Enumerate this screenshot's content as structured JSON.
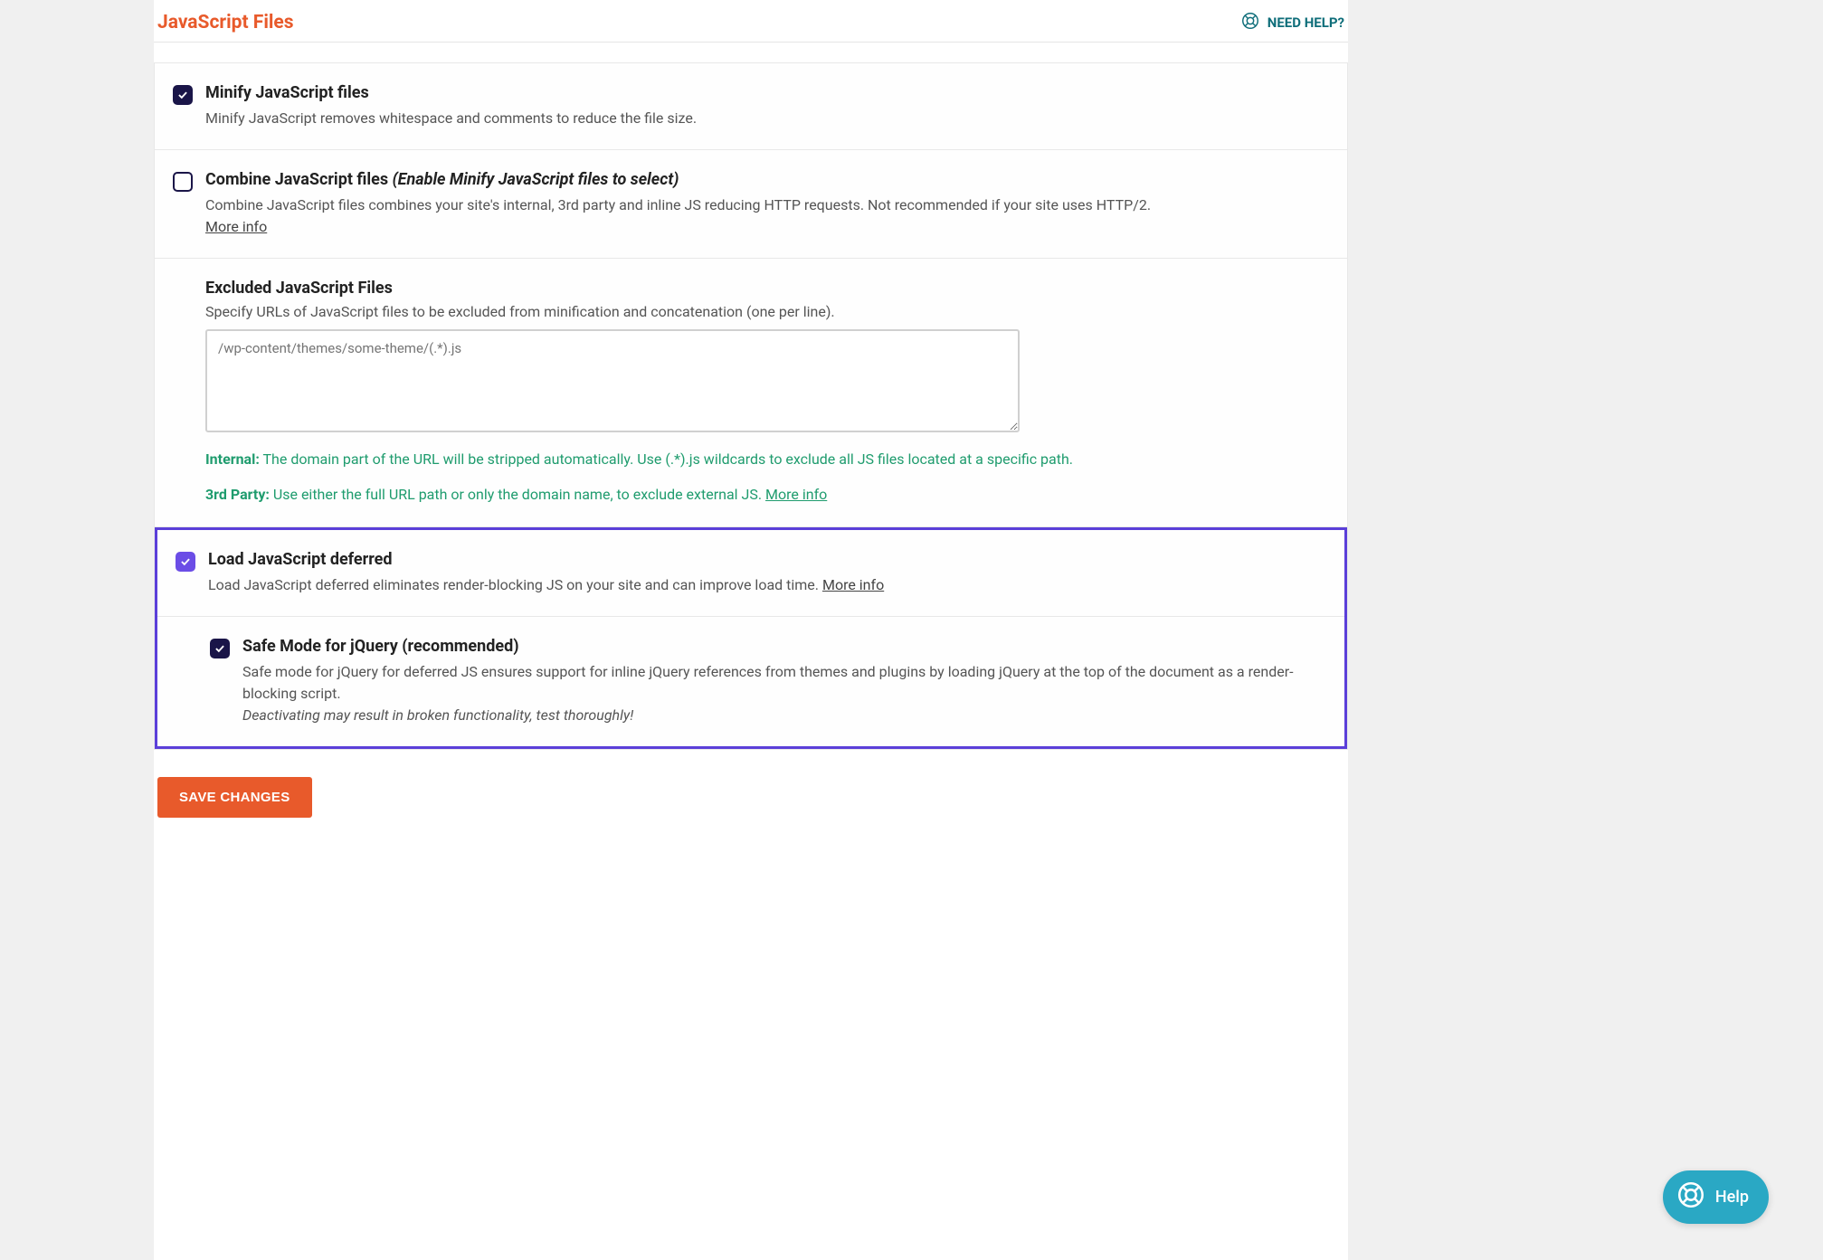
{
  "header": {
    "title": "JavaScript Files",
    "help_label": "NEED HELP?"
  },
  "settings": {
    "minify": {
      "title": "Minify JavaScript files",
      "desc": "Minify JavaScript removes whitespace and comments to reduce the file size."
    },
    "combine": {
      "title": "Combine JavaScript files",
      "hint": "(Enable Minify JavaScript files to select)",
      "desc": "Combine JavaScript files combines your site's internal, 3rd party and inline JS reducing HTTP requests. Not recommended if your site uses HTTP/2.",
      "more": "More info"
    },
    "excluded": {
      "title": "Excluded JavaScript Files",
      "desc": "Specify URLs of JavaScript files to be excluded from minification and concatenation (one per line).",
      "placeholder": "/wp-content/themes/some-theme/(.*).js",
      "note_internal_label": "Internal:",
      "note_internal_text": " The domain part of the URL will be stripped automatically. Use (.*).js wildcards to exclude all JS files located at a specific path.",
      "note_3rd_label": "3rd Party:",
      "note_3rd_text": " Use either the full URL path or only the domain name, to exclude external JS. ",
      "more": "More info"
    },
    "defer": {
      "title": "Load JavaScript deferred",
      "desc": "Load JavaScript deferred eliminates render-blocking JS on your site and can improve load time. ",
      "more": "More info"
    },
    "safe_mode": {
      "title": "Safe Mode for jQuery (recommended)",
      "desc": "Safe mode for jQuery for deferred JS ensures support for inline jQuery references from themes and plugins by loading jQuery at the top of the document as a render-blocking script.",
      "warn": "Deactivating may result in broken functionality, test thoroughly!"
    }
  },
  "buttons": {
    "save": "SAVE CHANGES"
  },
  "fab": {
    "label": "Help"
  }
}
